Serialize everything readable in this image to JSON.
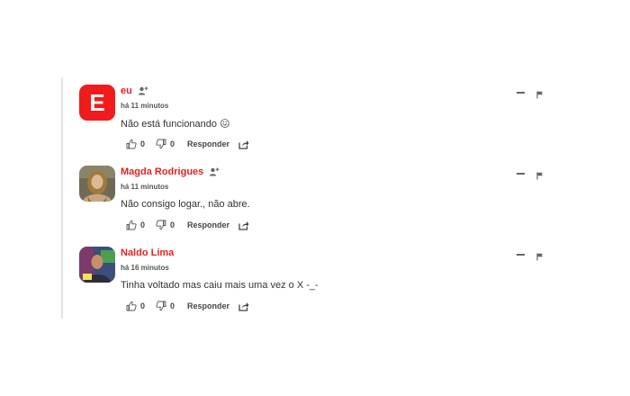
{
  "comments": [
    {
      "author": "eu",
      "avatar_letter": "E",
      "time": "há 11 minutos",
      "text": "Não está funcionando 😖",
      "likes": "0",
      "dislikes": "0",
      "reply_label": "Responder"
    },
    {
      "author": "Magda Rodrigues",
      "time": "há 11 minutos",
      "text": "Não consigo logar., não abre.",
      "likes": "0",
      "dislikes": "0",
      "reply_label": "Responder"
    },
    {
      "author": "Naldo Lima",
      "time": "há 16 minutos",
      "text": "Tinha voltado mas caiu mais uma vez o X -_-",
      "likes": "0",
      "dislikes": "0",
      "reply_label": "Responder"
    }
  ],
  "colors": {
    "accent": "#e8201f",
    "avatar_bg": "#ee1c1c",
    "thread_line": "#e2e2e2"
  },
  "icons": [
    "follow-icon",
    "thumbs-up-icon",
    "thumbs-down-icon",
    "share-icon",
    "minimize-icon",
    "flag-icon"
  ]
}
